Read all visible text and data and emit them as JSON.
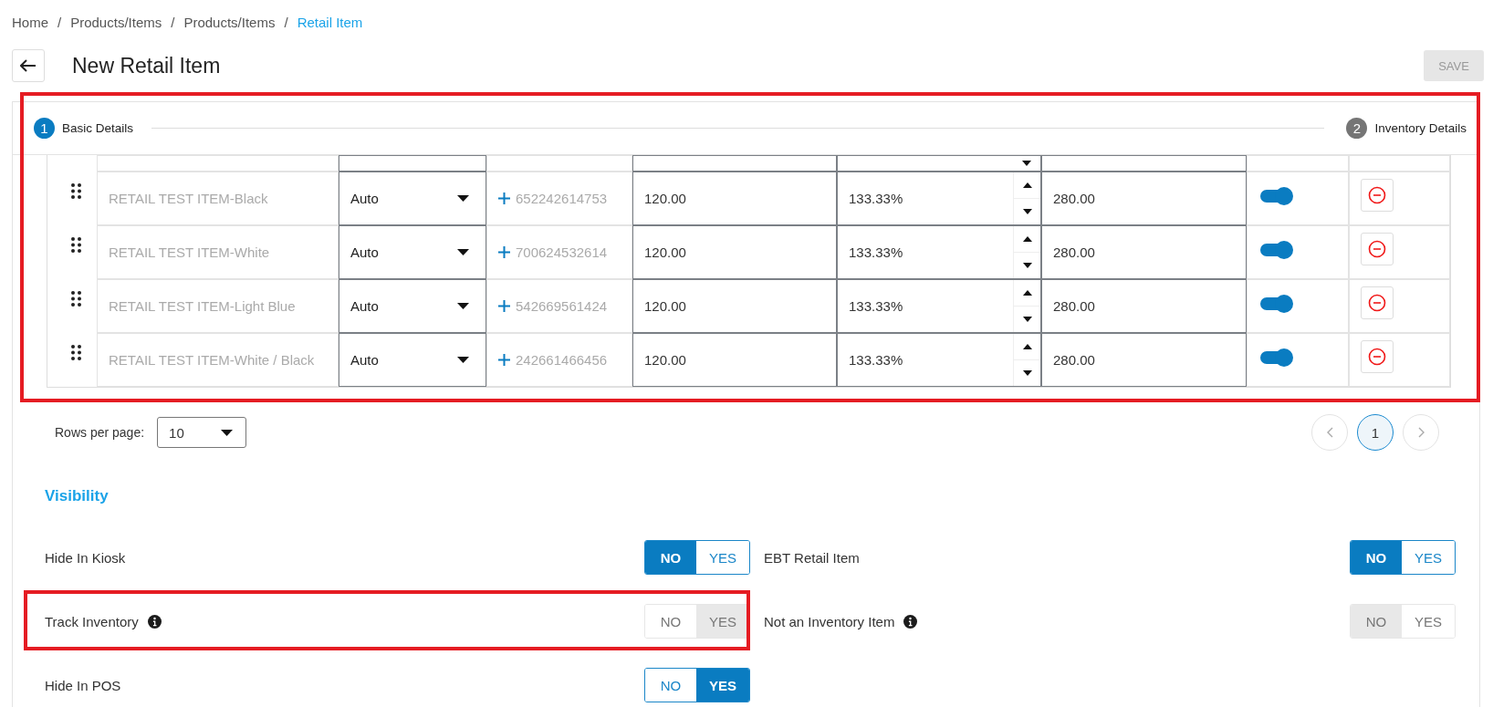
{
  "breadcrumb": {
    "separator": "/",
    "items": [
      {
        "label": "Home",
        "current": false
      },
      {
        "label": "Products/Items",
        "current": false
      },
      {
        "label": "Products/Items",
        "current": false
      },
      {
        "label": "Retail Item",
        "current": true
      }
    ]
  },
  "page": {
    "title": "New Retail Item",
    "save_button": {
      "label": "SAVE",
      "disabled": true
    }
  },
  "stepper": [
    {
      "number": "1",
      "label": "Basic Details",
      "active": true
    },
    {
      "number": "2",
      "label": "Inventory Details",
      "active": false
    }
  ],
  "variants": [
    {
      "name": "RETAIL TEST ITEM-Black",
      "type": "Auto",
      "barcode": "652242614753",
      "cost": "120.00",
      "markup": "133.33%",
      "price": "280.00",
      "enabled": true
    },
    {
      "name": "RETAIL TEST ITEM-White",
      "type": "Auto",
      "barcode": "700624532614",
      "cost": "120.00",
      "markup": "133.33%",
      "price": "280.00",
      "enabled": true
    },
    {
      "name": "RETAIL TEST ITEM-Light Blue",
      "type": "Auto",
      "barcode": "542669561424",
      "cost": "120.00",
      "markup": "133.33%",
      "price": "280.00",
      "enabled": true
    },
    {
      "name": "RETAIL TEST ITEM-White / Black",
      "type": "Auto",
      "barcode": "242661466456",
      "cost": "120.00",
      "markup": "133.33%",
      "price": "280.00",
      "enabled": true
    }
  ],
  "pagination": {
    "rows_per_page_label": "Rows per page:",
    "rows_per_page": "10",
    "pages": [
      {
        "label": "1",
        "selected": true
      }
    ]
  },
  "visibility": {
    "title": "Visibility",
    "settings": [
      {
        "label": "Hide In Kiosk",
        "info": false,
        "disabled": false,
        "options": [
          {
            "label": "NO",
            "selected": true
          },
          {
            "label": "YES",
            "selected": false
          }
        ]
      },
      {
        "label": "EBT Retail Item",
        "info": false,
        "disabled": false,
        "options": [
          {
            "label": "NO",
            "selected": true
          },
          {
            "label": "YES",
            "selected": false
          }
        ]
      },
      {
        "label": "Track Inventory",
        "info": true,
        "disabled": true,
        "options": [
          {
            "label": "NO",
            "selected": false
          },
          {
            "label": "YES",
            "selected": true
          }
        ]
      },
      {
        "label": "Not an Inventory Item",
        "info": true,
        "disabled": true,
        "options": [
          {
            "label": "NO",
            "selected": true
          },
          {
            "label": "YES",
            "selected": false
          }
        ]
      },
      {
        "label": "Hide In POS",
        "info": false,
        "disabled": false,
        "options": [
          {
            "label": "NO",
            "selected": false
          },
          {
            "label": "YES",
            "selected": true
          }
        ]
      }
    ]
  }
}
